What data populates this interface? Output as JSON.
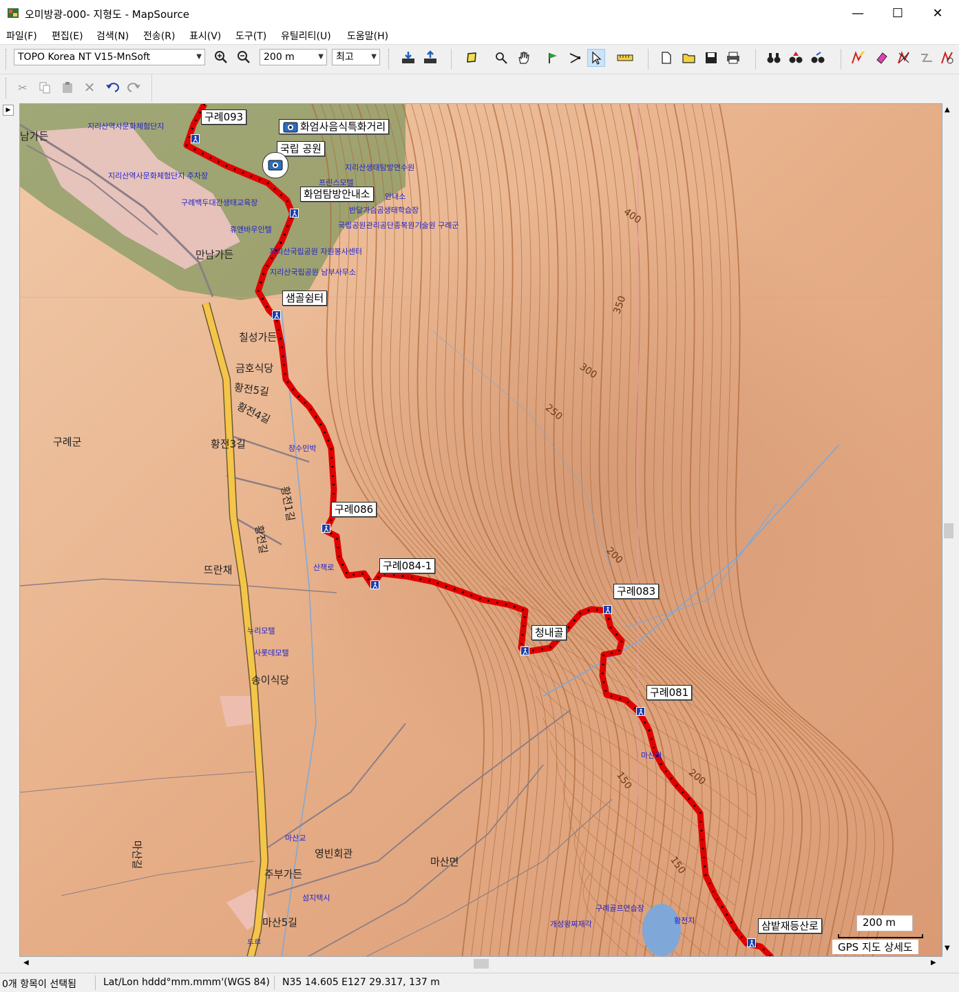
{
  "window": {
    "title": "오미방광-000- 지형도 - MapSource",
    "minimize_glyph": "—",
    "maximize_glyph": "☐",
    "close_glyph": "✕"
  },
  "menu": [
    {
      "label": "파일(F)"
    },
    {
      "label": "편집(E)"
    },
    {
      "label": "검색(N)"
    },
    {
      "label": "전송(R)"
    },
    {
      "label": "표시(V)"
    },
    {
      "label": "도구(T)"
    },
    {
      "label": "유틸리티(U)"
    },
    {
      "label": "도움말(H)"
    }
  ],
  "toolbar": {
    "map_product": "TOPO Korea NT V15-MnSoft",
    "zoom_level": "200 m",
    "detail": "최고"
  },
  "map": {
    "waypoints": [
      "구례093",
      "화엄사음식특화거리",
      "국립 공원",
      "화엄탐방안내소",
      "샘골쉼터",
      "구례086",
      "구례084-1",
      "청내골",
      "구례083",
      "구례081",
      "삼밭재등산로"
    ],
    "places": [
      "남가든",
      "만남가든",
      "칠성가든",
      "금호식당",
      "황전5길",
      "황전4길",
      "황전3길",
      "구례군",
      "황전1길",
      "황전길",
      "뜨란채",
      "송이식당",
      "마산교",
      "영빈회관",
      "주부가든",
      "마산면",
      "마산5길",
      "마산길",
      "두루",
      "장수민박",
      "산책로",
      "마산리",
      "누리모텔",
      "사롯데모텔"
    ],
    "pois": [
      "지리산역사문화체험단지",
      "지리산역사문화체험단지 주차장",
      "구례백두대간생태교육장",
      "지리산생태탐방연수원",
      "프린스모텔",
      "안내소",
      "반달가슴곰생태학습장",
      "국립공원관리공단종복원기술원 구례군",
      "휴앤바우인텔",
      "지리산국립공원 자원봉사센터",
      "지리산국립공원 남부사무소",
      "섬지택시",
      "구례골프연습장",
      "개성왕찌재각",
      "황전지"
    ],
    "contours": [
      "400",
      "350",
      "300",
      "250",
      "200",
      "150",
      "200",
      "150"
    ],
    "scale_value": "200 m",
    "map_mode": "GPS 지도 상세도"
  },
  "status": {
    "selection": "0개 항목이 선택됨",
    "format": "Lat/Lon hddd°mm.mmm'(WGS 84)",
    "position": "N35 14.605 E127 29.317, 137 m"
  },
  "colors": {
    "track": "#e00000",
    "terrain": "#e8b692",
    "contour": "#b06a3a",
    "road": "#f5c54a",
    "water": "#7fa8d8"
  }
}
